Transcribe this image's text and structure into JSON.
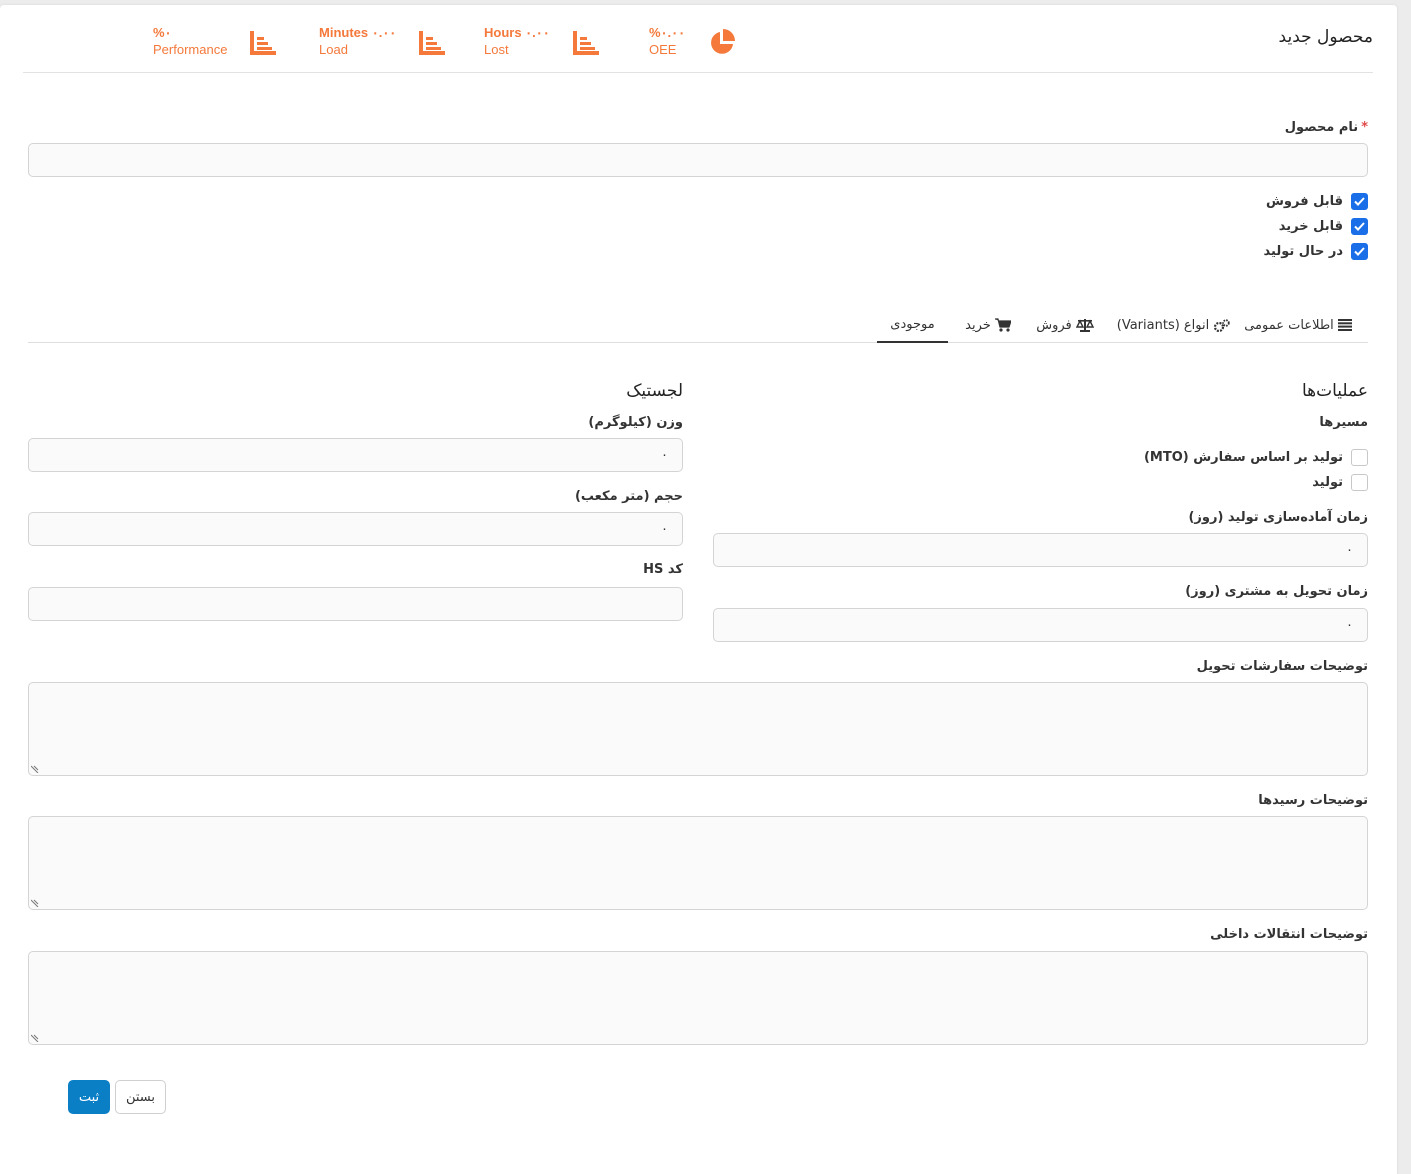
{
  "header": {
    "title": "محصول جدید",
    "kpis": [
      {
        "value": "%۰",
        "label": "Performance",
        "icon": "bar-chart-icon"
      },
      {
        "value": "Minutes ۰.۰۰",
        "label": "Load",
        "icon": "bar-chart-icon"
      },
      {
        "value": "Hours ۰.۰۰",
        "label": "Lost",
        "icon": "bar-chart-icon"
      },
      {
        "value": "%۰.۰۰",
        "label": "OEE",
        "icon": "pie-chart-icon"
      }
    ],
    "accent_color": "#f4793b"
  },
  "form": {
    "product_name_label": "نام محصول",
    "product_name_required": "*",
    "product_name_value": "",
    "checkboxes": [
      {
        "label": "قابل فروش",
        "checked": true
      },
      {
        "label": "قابل خرید",
        "checked": true
      },
      {
        "label": "در حال تولید",
        "checked": true
      }
    ]
  },
  "tabs": [
    {
      "label": "اطلاعات عمومی",
      "icon": "list-icon",
      "active": false
    },
    {
      "label": "انواع (Variants)",
      "icon": "gears-icon",
      "active": false
    },
    {
      "label": "فروش",
      "icon": "scale-icon",
      "active": false
    },
    {
      "label": "خرید",
      "icon": "cart-icon",
      "active": false
    },
    {
      "label": "موجودی",
      "icon": "",
      "active": true
    }
  ],
  "operations": {
    "title": "عملیات‌ها",
    "routes_label": "مسیرها",
    "routes": [
      {
        "label": "تولید بر اساس سفارش (MTO)",
        "checked": false
      },
      {
        "label": "تولید",
        "checked": false
      }
    ],
    "manufacturing_lead_label": "زمان آماده‌سازی تولید (روز)",
    "manufacturing_lead_value": "۰",
    "customer_lead_label": "زمان تحویل به مشتری (روز)",
    "customer_lead_value": "۰"
  },
  "logistics": {
    "title": "لجستیک",
    "weight_label": "وزن (کیلوگرم)",
    "weight_value": "۰",
    "volume_label": "حجم (متر مکعب)",
    "volume_value": "۰",
    "hs_code_label": "کد HS",
    "hs_code_value": ""
  },
  "descriptions": {
    "delivery_label": "توضیحات سفارشات تحویل",
    "receipts_label": "توضیحات رسیدها",
    "internal_label": "توضیحات انتقالات داخلی"
  },
  "actions": {
    "save_label": "ثبت",
    "close_label": "بستن"
  },
  "colors": {
    "primary": "#0a7fc6",
    "checkbox_on": "#1a6fe8"
  }
}
